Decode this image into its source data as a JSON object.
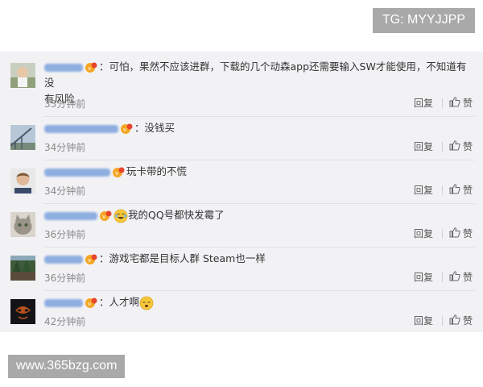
{
  "watermarks": {
    "top_right": "TG: MYYJJPP",
    "bottom_left": "www.365bzg.com"
  },
  "comments": [
    {
      "avatar": "avatar-child-photo",
      "text_line1": "：可怕，果然不应该进群，下载的几个动森app还需要输入SW才能使用，不知道有没",
      "text_line2": "有风险",
      "time": "33分钟前",
      "reply": "回复",
      "like": "赞"
    },
    {
      "avatar": "avatar-bridge-photo",
      "text_line1": "：没钱买",
      "time": "34分钟前",
      "reply": "回复",
      "like": "赞"
    },
    {
      "avatar": "avatar-man-portrait",
      "text_line1": "玩卡带的不慌",
      "time": "34分钟前",
      "reply": "回复",
      "like": "赞"
    },
    {
      "avatar": "avatar-cat-photo",
      "text_line1": "我的QQ号都快发霉了",
      "time": "36分钟前",
      "reply": "回复",
      "like": "赞"
    },
    {
      "avatar": "avatar-forest-photo",
      "text_line1": "：游戏宅都是目标人群 Steam也一样",
      "time": "36分钟前",
      "reply": "回复",
      "like": "赞"
    },
    {
      "avatar": "avatar-dark-mask",
      "text_line1": "：人才啊",
      "time": "42分钟前",
      "reply": "回复",
      "like": "赞"
    }
  ],
  "colors": {
    "panel_bg": "#f2f2f5",
    "username_blue": "#5b8fd6",
    "time_gray": "#8a8a8a",
    "watermark_bg": "#a9a9a9"
  }
}
